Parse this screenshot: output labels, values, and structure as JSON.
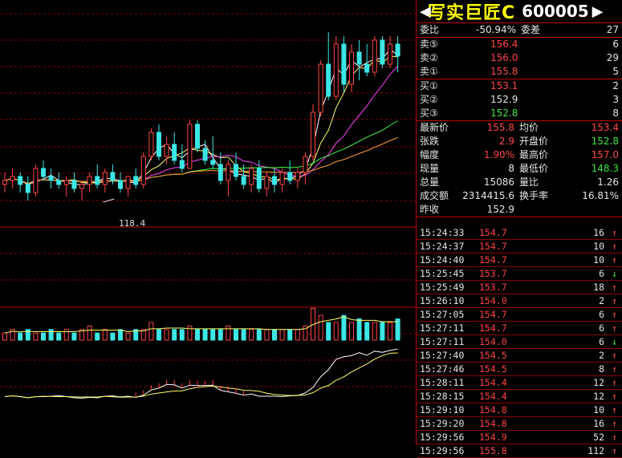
{
  "stock": {
    "name": "写实巨匠C",
    "code": "600005"
  },
  "chart": {
    "low_label": "118.4"
  },
  "chart_data": {
    "type": "candlestick",
    "low_annotation": "118.4",
    "candles": [
      [
        120,
        123,
        118,
        121
      ],
      [
        121,
        124,
        119,
        122
      ],
      [
        122,
        123,
        118,
        120
      ],
      [
        120,
        122,
        116,
        118
      ],
      [
        118,
        125,
        117,
        124
      ],
      [
        124,
        126,
        121,
        122
      ],
      [
        122,
        124,
        119,
        121
      ],
      [
        121,
        123,
        119,
        120
      ],
      [
        120,
        122,
        117,
        121
      ],
      [
        121,
        123,
        118,
        119
      ],
      [
        119,
        121,
        116,
        120
      ],
      [
        120,
        123,
        118,
        122
      ],
      [
        122,
        125,
        119,
        120
      ],
      [
        120,
        124,
        118,
        123
      ],
      [
        123,
        125,
        120,
        121
      ],
      [
        121,
        123,
        118,
        119
      ],
      [
        119,
        122,
        117,
        122
      ],
      [
        122,
        124,
        119,
        120
      ],
      [
        120,
        128,
        119,
        127
      ],
      [
        127,
        134,
        126,
        133
      ],
      [
        133,
        135,
        126,
        127
      ],
      [
        127,
        132,
        125,
        130
      ],
      [
        130,
        133,
        125,
        126
      ],
      [
        126,
        130,
        123,
        124
      ],
      [
        124,
        136,
        124,
        135
      ],
      [
        135,
        136,
        128,
        129
      ],
      [
        129,
        131,
        125,
        126
      ],
      [
        126,
        132,
        124,
        125
      ],
      [
        125,
        128,
        120,
        121
      ],
      [
        121,
        126,
        117,
        125
      ],
      [
        125,
        128,
        121,
        122
      ],
      [
        122,
        125,
        119,
        120
      ],
      [
        120,
        125,
        118,
        124
      ],
      [
        124,
        126,
        118,
        119
      ],
      [
        119,
        123,
        117,
        122
      ],
      [
        122,
        124,
        118,
        120
      ],
      [
        120,
        124,
        118,
        123
      ],
      [
        123,
        126,
        120,
        121
      ],
      [
        121,
        124,
        119,
        123
      ],
      [
        123,
        128,
        120,
        127
      ],
      [
        127,
        140,
        126,
        138
      ],
      [
        138,
        151,
        137,
        150
      ],
      [
        150,
        158,
        141,
        142
      ],
      [
        142,
        157,
        141,
        155
      ],
      [
        155,
        157,
        143,
        145
      ],
      [
        145,
        155,
        143,
        153
      ],
      [
        153,
        156,
        146,
        150
      ],
      [
        150,
        155,
        147,
        148
      ],
      [
        148,
        157,
        147,
        156
      ],
      [
        156,
        157,
        149,
        150
      ],
      [
        150,
        157,
        149,
        155
      ],
      [
        155,
        157,
        148,
        152
      ]
    ],
    "volume": [
      2,
      3,
      2,
      3,
      2,
      2,
      3,
      2,
      3,
      2,
      3,
      4,
      2,
      3,
      2,
      3,
      2,
      3,
      3,
      5,
      3,
      3,
      3,
      3,
      4,
      3,
      3,
      3,
      3,
      4,
      3,
      3,
      3,
      3,
      3,
      3,
      3,
      3,
      3,
      4,
      9,
      7,
      5,
      5,
      7,
      5,
      6,
      5,
      5,
      5,
      5,
      6
    ],
    "volume_colors": [
      "#ff4545",
      "#3ce6e6"
    ]
  },
  "quote": {
    "weibi": {
      "label": "委比",
      "value": "-50.94%",
      "label2": "委差",
      "value2": "27"
    },
    "sell": [
      {
        "label": "卖⑤",
        "price": "156.4",
        "vol": "6"
      },
      {
        "label": "卖②",
        "price": "156.0",
        "vol": "29"
      },
      {
        "label": "卖①",
        "price": "155.8",
        "vol": "5"
      }
    ],
    "buy": [
      {
        "label": "买①",
        "price": "153.1",
        "vol": "2"
      },
      {
        "label": "买②",
        "price": "152.9",
        "vol": "3"
      },
      {
        "label": "买③",
        "price": "152.8",
        "vol": "8"
      }
    ],
    "stats": [
      {
        "l1": "最新价",
        "v1": "155.8",
        "c1": "red",
        "l2": "均价",
        "v2": "153.4",
        "c2": "red"
      },
      {
        "l1": "张跌",
        "v1": "2.9",
        "c1": "red",
        "l2": "开盘价",
        "v2": "152.8",
        "c2": "green"
      },
      {
        "l1": "幅度",
        "v1": "1.90%",
        "c1": "red",
        "l2": "最高价",
        "v2": "157.0",
        "c2": "red"
      },
      {
        "l1": "现量",
        "v1": "8",
        "c1": "white",
        "l2": "最低价",
        "v2": "148.3",
        "c2": "green"
      },
      {
        "l1": "总量",
        "v1": "15086",
        "c1": "white",
        "l2": "量比",
        "v2": "1.26",
        "c2": "white"
      },
      {
        "l1": "成交额",
        "v1": "2314415.6",
        "c1": "white",
        "l2": "换手率",
        "v2": "16.81%",
        "c2": "white"
      },
      {
        "l1": "昨收",
        "v1": "152.9",
        "c1": "white",
        "l2": "",
        "v2": "",
        "c2": "white"
      }
    ]
  },
  "ticks": [
    {
      "time": "15:24:33",
      "price": "154.7",
      "vol": "16",
      "dir": "↑"
    },
    {
      "time": "15:24:37",
      "price": "154.7",
      "vol": "10",
      "dir": "↑"
    },
    {
      "time": "15:24:40",
      "price": "154.7",
      "vol": "10",
      "dir": "↑"
    },
    {
      "time": "15:25:45",
      "price": "153.7",
      "vol": "6",
      "dir": "↓"
    },
    {
      "time": "15:25:49",
      "price": "153.7",
      "vol": "18",
      "dir": "↑"
    },
    {
      "time": "15:26:10",
      "price": "154.0",
      "vol": "2",
      "dir": "↑"
    },
    {
      "time": "15:27:05",
      "price": "154.7",
      "vol": "6",
      "dir": "↑"
    },
    {
      "time": "15:27:11",
      "price": "154.7",
      "vol": "6",
      "dir": "↑"
    },
    {
      "time": "15:27:11",
      "price": "154.0",
      "vol": "6",
      "dir": "↓"
    },
    {
      "time": "15:27:40",
      "price": "154.5",
      "vol": "2",
      "dir": "↑"
    },
    {
      "time": "15:27:46",
      "price": "154.5",
      "vol": "8",
      "dir": "↑"
    },
    {
      "time": "15:28:11",
      "price": "154.4",
      "vol": "12",
      "dir": "↑"
    },
    {
      "time": "15:28:15",
      "price": "154.4",
      "vol": "12",
      "dir": "↑"
    },
    {
      "time": "15:29:10",
      "price": "154.8",
      "vol": "10",
      "dir": "↑"
    },
    {
      "time": "15:29:20",
      "price": "154.8",
      "vol": "16",
      "dir": "↑"
    },
    {
      "time": "15:29:56",
      "price": "154.9",
      "vol": "52",
      "dir": "↑"
    },
    {
      "time": "15:29:56",
      "price": "155.8",
      "vol": "112",
      "dir": "↑"
    }
  ]
}
